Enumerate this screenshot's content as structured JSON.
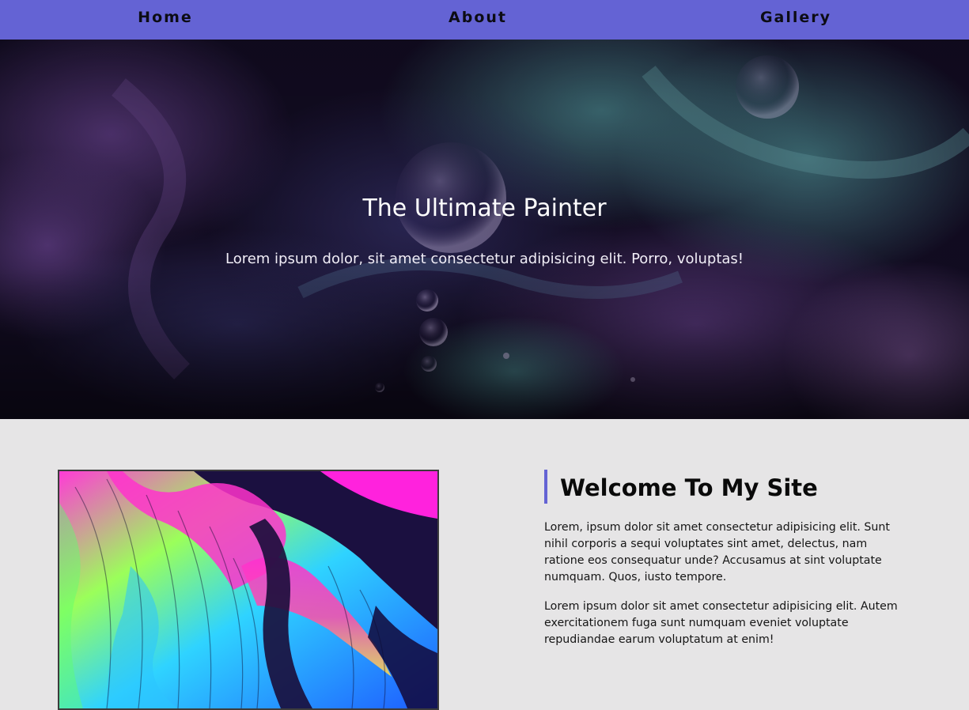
{
  "nav": {
    "items": [
      {
        "label": "Home"
      },
      {
        "label": "About"
      },
      {
        "label": "Gallery"
      }
    ],
    "background": "#6463d4"
  },
  "hero": {
    "title": "The Ultimate Painter",
    "subtitle": "Lorem ipsum dolor, sit amet consectetur adipisicing elit. Porro, voluptas!"
  },
  "welcome": {
    "heading": "Welcome To My Site",
    "paragraphs": [
      "Lorem, ipsum dolor sit amet consectetur adipisicing elit. Sunt nihil corporis a sequi voluptates sint amet, delectus, nam ratione eos consequatur unde? Accusamus at sint voluptate numquam. Quos, iusto tempore.",
      "Lorem ipsum dolor sit amet consectetur adipisicing elit. Autem exercitationem fuga sunt numquam eveniet voluptate repudiandae earum voluptatum at enim!"
    ]
  },
  "colors": {
    "accent": "#6463d4",
    "page_background": "#e6e5e6"
  }
}
